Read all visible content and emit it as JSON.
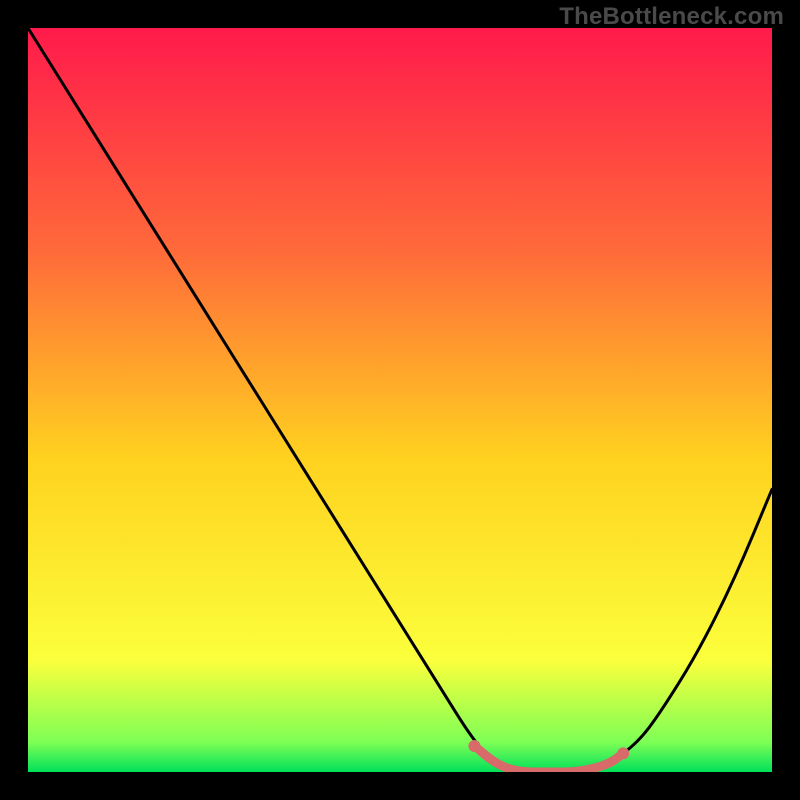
{
  "watermark": "TheBottleneck.com",
  "chart_data": {
    "type": "line",
    "title": "",
    "xlabel": "",
    "ylabel": "",
    "xlim": [
      0,
      100
    ],
    "ylim": [
      0,
      100
    ],
    "grid": false,
    "series": [
      {
        "name": "bottleneck-curve",
        "x": [
          0,
          5,
          10,
          15,
          20,
          25,
          30,
          35,
          40,
          45,
          50,
          55,
          60,
          63,
          66,
          70,
          74,
          78,
          82,
          85,
          90,
          95,
          100
        ],
        "y": [
          100,
          92,
          84,
          76,
          68,
          60,
          52,
          44,
          36,
          28,
          20,
          12,
          4,
          1,
          0,
          0,
          0,
          1,
          4,
          8,
          16,
          26,
          38
        ],
        "color": "#000000"
      }
    ],
    "highlight": {
      "name": "optimal-zone",
      "x": [
        60,
        63,
        66,
        70,
        74,
        78,
        80
      ],
      "y": [
        3.5,
        1,
        0,
        0,
        0,
        1,
        2.5
      ],
      "color": "#d86a6a"
    },
    "background_gradient": {
      "top": "#ff1a4b",
      "mid1": "#ff6a3a",
      "mid2": "#ffd21f",
      "mid3": "#fbff3c",
      "bottom_band": "#7dff55",
      "bottom": "#00e05a"
    }
  }
}
